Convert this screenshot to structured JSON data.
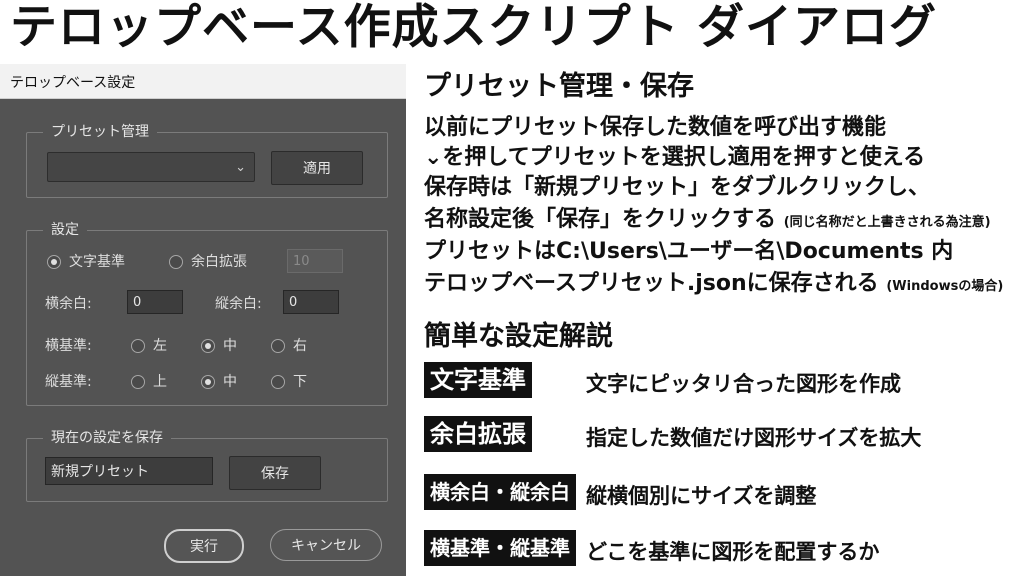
{
  "headline": "テロップベース作成スクリプト ダイアログ",
  "dialog": {
    "window_title": "テロップベース設定",
    "preset_group": {
      "legend": "プリセット管理",
      "dropdown_value": "",
      "apply_label": "適用"
    },
    "settings_group": {
      "legend": "設定",
      "mode_text_basis": "文字基準",
      "mode_margin_expand": "余白拡張",
      "margin_expand_value": "10",
      "h_margin_label": "横余白:",
      "h_margin_value": "0",
      "v_margin_label": "縦余白:",
      "v_margin_value": "0",
      "h_basis_label": "横基準:",
      "h_options": [
        "左",
        "中",
        "右"
      ],
      "h_selected": "中",
      "v_basis_label": "縦基準:",
      "v_options": [
        "上",
        "中",
        "下"
      ],
      "v_selected": "中"
    },
    "save_group": {
      "legend": "現在の設定を保存",
      "name_value": "新規プリセット",
      "save_label": "保存"
    },
    "run_label": "実行",
    "cancel_label": "キャンセル"
  },
  "help": {
    "preset_heading": "プリセット管理・保存",
    "line1": "以前にプリセット保存した数値を呼び出す機能",
    "line2": "⌄を押してプリセットを選択し適用を押すと使える",
    "line3": "保存時は「新規プリセット」をダブルクリックし、",
    "line4": "名称設定後「保存」をクリックする",
    "line4_note": "(同じ名称だと上書きされる為注意)",
    "line5": "プリセットはC:\\Users\\ユーザー名\\Documents 内",
    "line6": "テロップベースプリセット.jsonに保存される",
    "line6_note": "(Windowsの場合)",
    "explain_heading": "簡単な設定解説",
    "items": [
      {
        "tag": "文字基準",
        "desc": "文字にピッタリ合った図形を作成"
      },
      {
        "tag": "余白拡張",
        "desc": "指定した数値だけ図形サイズを拡大"
      },
      {
        "tag": "横余白・縦余白",
        "desc": "縦横個別にサイズを調整"
      },
      {
        "tag": "横基準・縦基準",
        "desc": "どこを基準に図形を配置するか"
      }
    ]
  }
}
